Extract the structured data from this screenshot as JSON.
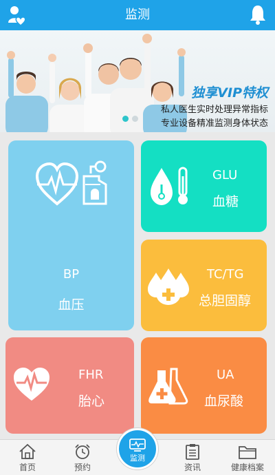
{
  "header": {
    "title": "监测"
  },
  "banner": {
    "headline": "独享VIP特权",
    "line1": "私人医生实时处理异常指标",
    "line2": "专业设备精准监测身体状态"
  },
  "tiles": {
    "bp": {
      "code": "BP",
      "name": "血压"
    },
    "glu": {
      "code": "GLU",
      "name": "血糖"
    },
    "tc": {
      "code": "TC/TG",
      "name": "总胆固醇"
    },
    "fhr": {
      "code": "FHR",
      "name": "胎心"
    },
    "ua": {
      "code": "UA",
      "name": "血尿酸"
    }
  },
  "tabs": {
    "home": "首页",
    "appointment": "预约",
    "monitor": "监测",
    "news": "资讯",
    "records": "健康档案"
  },
  "colors": {
    "primary": "#1fa3e8",
    "bp": "#7fd0ef",
    "glu": "#14dfc3",
    "tc": "#fbbd3d",
    "fhr": "#f18b83",
    "ua": "#fa8c44"
  },
  "icons": {
    "top_left": "contacts-heart-icon",
    "top_right": "bell-icon"
  }
}
